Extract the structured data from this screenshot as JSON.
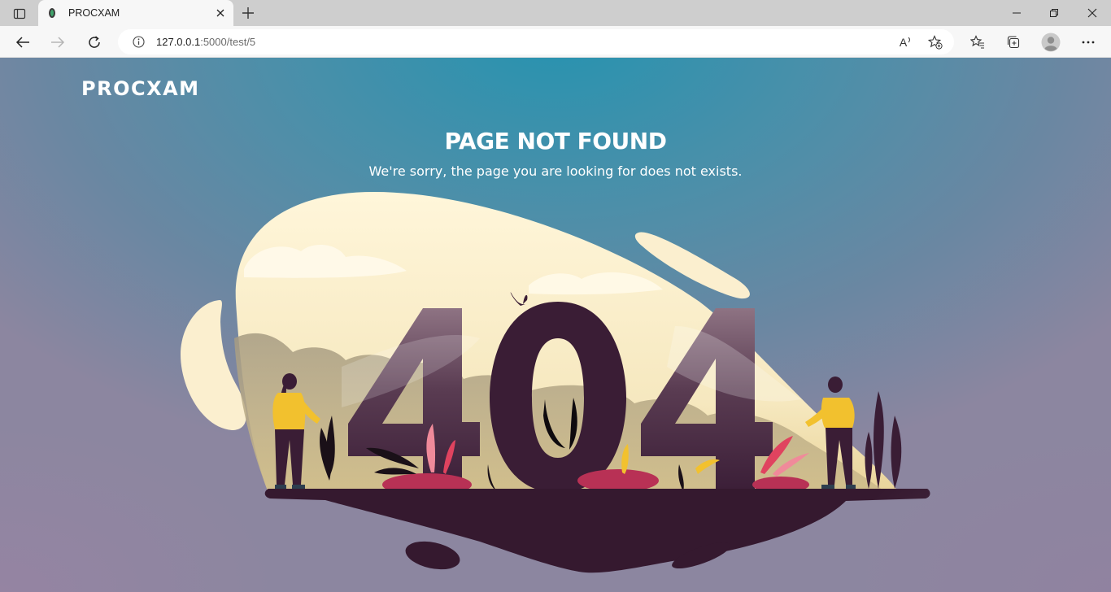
{
  "browser": {
    "tab": {
      "title": "PROCXAM"
    },
    "address": {
      "host": "127.0.0.1",
      "rest": ":5000/test/5"
    },
    "read_aloud_label": "A"
  },
  "page": {
    "logo": "PROCXAM",
    "title": "PAGE NOT FOUND",
    "subtitle": "We're sorry, the page you are looking for does not exists.",
    "illustration_text": "404"
  },
  "colors": {
    "bg_top": "#2693b0",
    "bg_bottom": "#8c86a0",
    "blob": "#fbefcf",
    "ground": "#35192f",
    "shirt": "#f2c12e",
    "foliage": "#b83155"
  }
}
